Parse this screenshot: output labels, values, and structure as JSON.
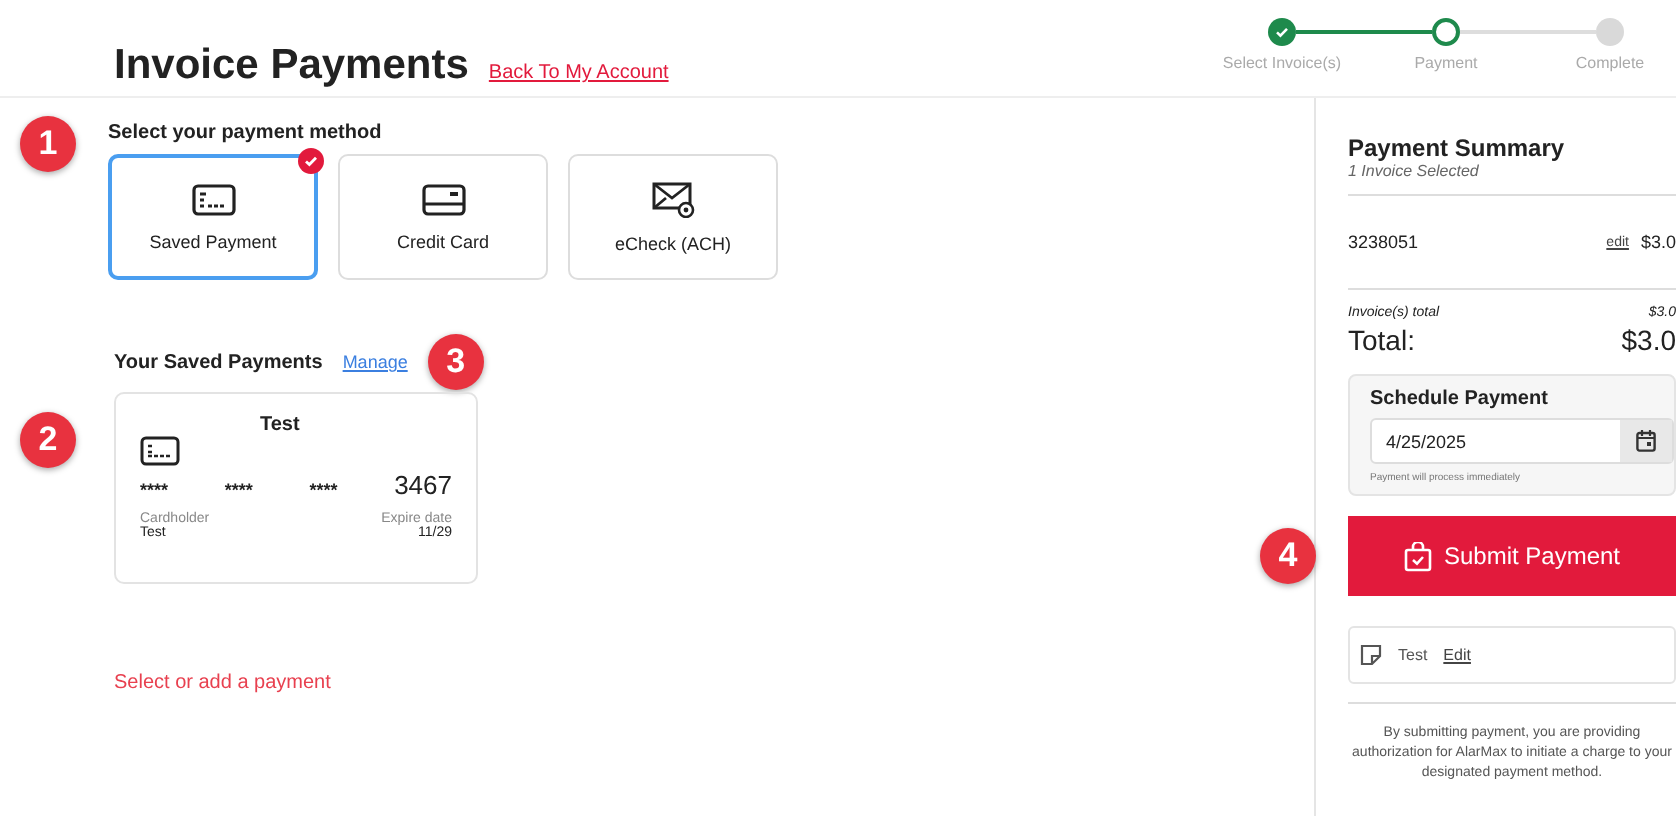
{
  "header": {
    "title": "Invoice Payments",
    "back_link": "Back To My Account"
  },
  "steps": [
    {
      "label": "Select Invoice(s)",
      "completed": true,
      "selected": false
    },
    {
      "label": "Payment",
      "completed": false,
      "selected": true
    },
    {
      "label": "Complete",
      "completed": false,
      "selected": false
    }
  ],
  "markers": [
    "1",
    "2",
    "3",
    "4"
  ],
  "method_section": {
    "heading": "Select your payment method",
    "methods": [
      {
        "label": "Saved Payment",
        "kind": "saved",
        "selected": true
      },
      {
        "label": "Credit Card",
        "kind": "card",
        "selected": false
      },
      {
        "label": "eCheck (ACH)",
        "kind": "echeck",
        "selected": false
      }
    ]
  },
  "saved_section": {
    "heading": "Your Saved Payments",
    "manage_link": "Manage",
    "card": {
      "name": "Test",
      "groups": [
        "****",
        "****",
        "****"
      ],
      "last4": "3467",
      "holder_label": "Cardholder",
      "holder": "Test",
      "expire_label": "Expire date",
      "expire": "11/29"
    }
  },
  "prompt": "Select or add a payment",
  "summary": {
    "title": "Payment Summary",
    "subtitle": "1 Invoice Selected",
    "invoice": {
      "number": "3238051",
      "edit": "edit",
      "amount": "$3.0"
    },
    "subtotal_label": "Invoice(s) total",
    "subtotal": "$3.0",
    "total_label": "Total:",
    "total": "$3.0",
    "schedule": {
      "heading": "Schedule Payment",
      "date": "4/25/2025",
      "hint": "Payment will process immediately"
    },
    "submit": "Submit Payment",
    "note": {
      "text": "Test",
      "edit": "Edit"
    },
    "disclaimer": "By submitting payment, you are providing authorization for AlarMax to initiate a charge to your designated payment method."
  }
}
